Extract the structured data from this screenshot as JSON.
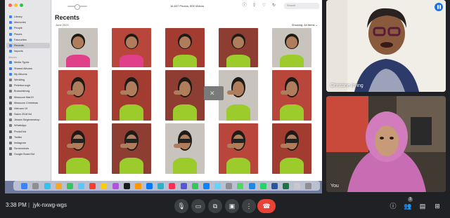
{
  "shared_screen": {
    "sidebar": {
      "sections": [
        {
          "items": [
            "Library",
            "Memories",
            "People",
            "Places",
            "Favourites",
            "Recents",
            "Imports"
          ],
          "selected_index": 5
        },
        {
          "header": "Albums",
          "items": [
            "Media Types",
            "Shared Albums",
            "My Albums",
            "Wedding",
            "Peterborough",
            "Brusselsburg",
            "Mosscow Mar19",
            "Mosscow Christmas",
            "Vietnam 19",
            "Salon 2018 list",
            "Jessen Beginnershop",
            "WhatsApp",
            "PhotoGrid",
            "Twitter",
            "Instagram",
            "Screenshots",
            "Google Board list"
          ]
        }
      ]
    },
    "toolbar": {
      "count_text": "16,637 Photos, 505 Videos",
      "search_placeholder": "Search"
    },
    "title": "Recents",
    "date_label": "June 2021",
    "showing_label": "Showing: All Items ⌄",
    "grid": {
      "columns": 5,
      "rows": 4,
      "photo_count": 20
    }
  },
  "participants": [
    {
      "name": "Christine Irving",
      "speaking": true
    },
    {
      "name": "You",
      "speaking": false
    }
  ],
  "bottom_bar": {
    "time": "3:38 PM",
    "separator": "|",
    "meeting_code": "jyk-nxwg-wgs",
    "people_count": "3",
    "controls": [
      "mic-icon",
      "camera-icon",
      "captions-icon",
      "present-icon",
      "more-icon",
      "end-call-icon"
    ],
    "right_controls": [
      "info-icon",
      "people-icon",
      "chat-icon",
      "activities-icon"
    ]
  },
  "colors": {
    "meet_bg": "#202124",
    "end_call": "#ea4335",
    "accent": "#1a73e8",
    "shirt": "#9ccc2c"
  }
}
